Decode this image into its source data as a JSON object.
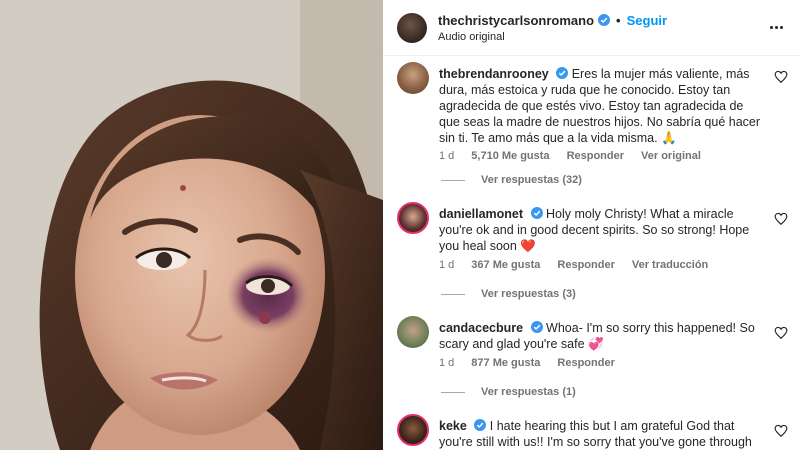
{
  "post": {
    "author": "thechristycarlsonromano",
    "separator": "•",
    "follow_label": "Seguir",
    "audio_label": "Audio original"
  },
  "comments": [
    {
      "username": "thebrendanrooney",
      "text": "Eres la mujer más valiente, más dura, más estoica y ruda que he conocido. Estoy tan agradecida de que estés vivo. Estoy tan agradecida de que seas la madre de nuestros hijos. No sabría qué hacer sin ti. Te amo más que a la vida misma. 🙏",
      "time": "1 d",
      "likes": "5,710 Me gusta",
      "reply_label": "Responder",
      "extra_label": "Ver original",
      "replies_label": "Ver respuestas (32)"
    },
    {
      "username": "daniellamonet",
      "text": "Holy moly Christy! What a miracle you're ok and in good decent spirits. So so strong! Hope you heal soon ❤️",
      "time": "1 d",
      "likes": "367 Me gusta",
      "reply_label": "Responder",
      "extra_label": "Ver traducción",
      "replies_label": "Ver respuestas (3)"
    },
    {
      "username": "candacecbure",
      "text": "Whoa- I'm so sorry this happened! So scary and glad you're safe 💞",
      "time": "1 d",
      "likes": "877 Me gusta",
      "reply_label": "Responder",
      "replies_label": "Ver respuestas (1)"
    },
    {
      "username": "keke",
      "text": "I hate hearing this but I am grateful God that you're still with us!! I'm so sorry that you've gone through this and"
    }
  ],
  "icons": {
    "verified": "verified-badge-icon",
    "heart": "heart-icon",
    "more": "more-options-icon"
  },
  "colors": {
    "accent": "#0095f6",
    "verified": "#3897f0",
    "bruise": "#6b3a63"
  }
}
